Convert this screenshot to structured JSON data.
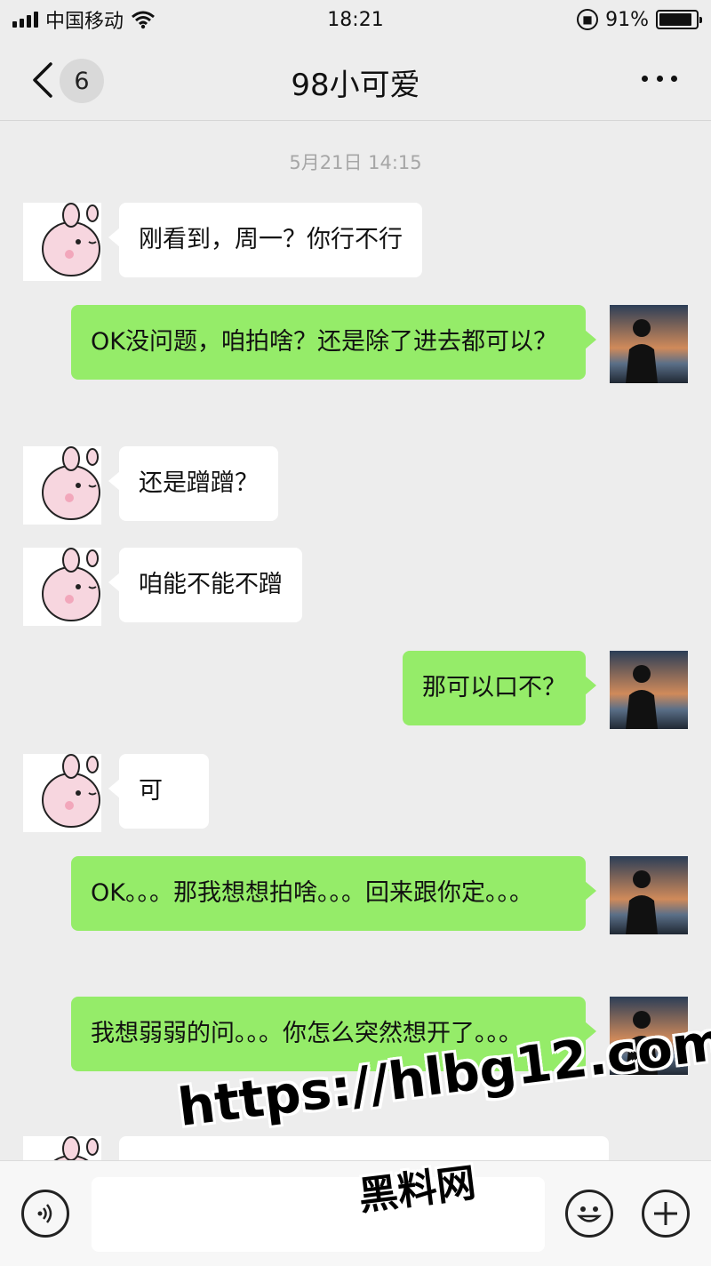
{
  "status_bar": {
    "carrier": "中国移动",
    "time": "18:21",
    "battery": "91%",
    "battery_level": 0.91
  },
  "nav": {
    "unread_count": "6",
    "title": "98小可爱"
  },
  "chat": {
    "timestamp": "5月21日 14:15",
    "messages": [
      {
        "side": "recv",
        "text": "刚看到，周一？你行不行"
      },
      {
        "side": "sent",
        "text": "OK没问题，咱拍啥？还是除了进去都可以？"
      },
      {
        "side": "recv",
        "text": "还是蹭蹭？"
      },
      {
        "side": "recv",
        "text": "咱能不能不蹭"
      },
      {
        "side": "sent",
        "text": "那可以口不？"
      },
      {
        "side": "recv",
        "text": "可"
      },
      {
        "side": "sent",
        "text": "OK。。。那我想想拍啥。。。回来跟你定。。。"
      },
      {
        "side": "sent",
        "text": "我想弱弱的问。。。你怎么突然想开了。。。"
      },
      {
        "side": "recv",
        "text": ""
      }
    ]
  },
  "watermark": {
    "url": "https://hlbg12.com",
    "name": "黑料网"
  },
  "icons": {
    "back": "chevron-left-icon",
    "more": "more-dots-icon",
    "voice": "voice-icon",
    "emoji": "emoji-icon",
    "plus": "plus-icon",
    "wifi": "wifi-icon",
    "signal": "signal-icon",
    "lock": "orientation-lock-icon",
    "battery": "battery-icon"
  },
  "colors": {
    "background": "#ededed",
    "sent_bubble": "#95ec69",
    "recv_bubble": "#ffffff"
  }
}
